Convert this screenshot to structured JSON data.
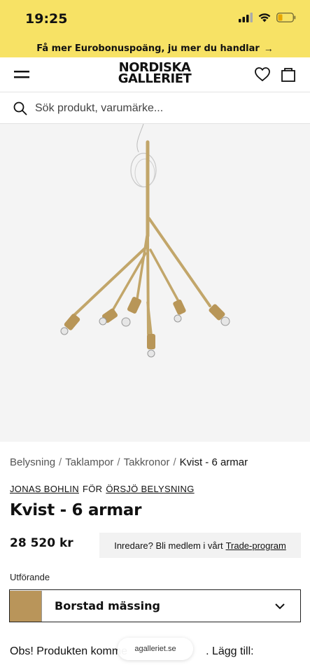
{
  "status": {
    "time": "19:25"
  },
  "promo": {
    "text": "Få mer Eurobonuspoäng, ju mer du handlar",
    "arrow": "→"
  },
  "header": {
    "logo_line1": "NORDISKA",
    "logo_line2": "GALLERIET"
  },
  "search": {
    "placeholder": "Sök produkt, varumärke..."
  },
  "breadcrumb": {
    "items": [
      "Belysning",
      "Taklampor",
      "Takkronor"
    ],
    "current": "Kvist - 6 armar",
    "separator": "/"
  },
  "brand": {
    "designer": "JONAS BOHLIN",
    "connector": "FÖR",
    "manufacturer": "ÖRSJÖ BELYSNING"
  },
  "product": {
    "title": "Kvist - 6 armar",
    "price": "28 520 kr"
  },
  "trade": {
    "text": "Inredare? Bli medlem i vårt",
    "link": "Trade-program"
  },
  "variant": {
    "label": "Utförande",
    "value": "Borstad mässing",
    "swatch_color": "#b9955a"
  },
  "notice": {
    "start": "Obs! Produkten komme",
    "end": ". Lägg till:"
  },
  "browser": {
    "url": "agalleriet.se"
  },
  "colors": {
    "accent_yellow": "#f7e265",
    "image_bg": "#f4f4f4",
    "brass": "#c2a66a"
  }
}
